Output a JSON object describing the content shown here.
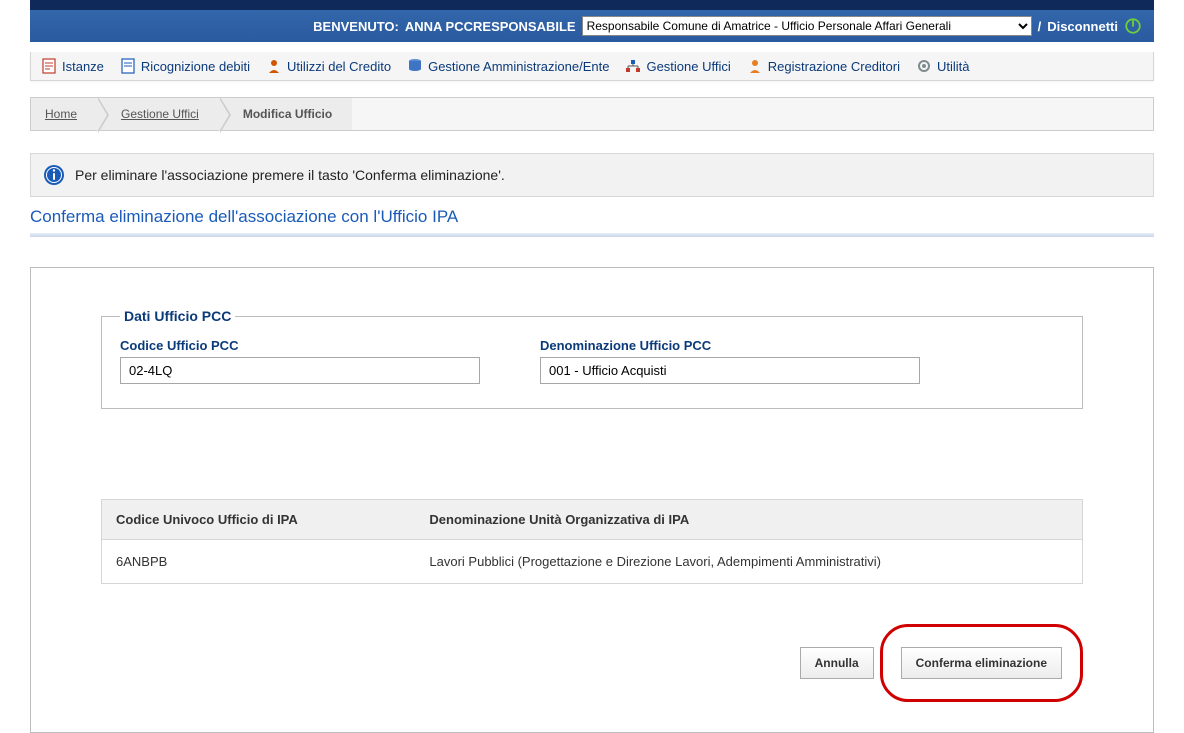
{
  "header": {
    "welcome_prefix": "BENVENUTO:",
    "username": "ANNA PCCRESPONSABILE",
    "role_selected": "Responsabile Comune di Amatrice - Ufficio Personale Affari Generali",
    "disconnect_label": "Disconnetti"
  },
  "nav": {
    "items": [
      {
        "label": "Istanze",
        "icon_color": "#c0392b"
      },
      {
        "label": "Ricognizione debiti",
        "icon_color": "#1a5bb8"
      },
      {
        "label": "Utilizzi del Credito",
        "icon_color": "#d35400"
      },
      {
        "label": "Gestione Amministrazione/Ente",
        "icon_color": "#1a5bb8"
      },
      {
        "label": "Gestione Uffici",
        "icon_color": "#1a5bb8"
      },
      {
        "label": "Registrazione Creditori",
        "icon_color": "#e67e22"
      },
      {
        "label": "Utilità",
        "icon_color": "#7f8c8d"
      }
    ]
  },
  "breadcrumb": {
    "items": [
      {
        "label": "Home",
        "link": true
      },
      {
        "label": "Gestione Uffici",
        "link": true
      },
      {
        "label": "Modifica Ufficio",
        "link": false
      }
    ]
  },
  "info_message": "Per eliminare l'associazione premere il tasto 'Conferma eliminazione'.",
  "page_title": "Conferma eliminazione dell'associazione con l'Ufficio IPA",
  "pcc_fieldset": {
    "legend": "Dati Ufficio PCC",
    "codice_label": "Codice Ufficio PCC",
    "codice_value": "02-4LQ",
    "denom_label": "Denominazione Ufficio PCC",
    "denom_value": "001 - Ufficio Acquisti"
  },
  "ipa_table": {
    "col1": "Codice Univoco Ufficio di IPA",
    "col2": "Denominazione Unità Organizzativa di IPA",
    "row": {
      "code": "6ANBPB",
      "name": "Lavori Pubblici (Progettazione e Direzione Lavori, Adempimenti Amministrativi)"
    }
  },
  "buttons": {
    "cancel": "Annulla",
    "confirm": "Conferma eliminazione"
  }
}
